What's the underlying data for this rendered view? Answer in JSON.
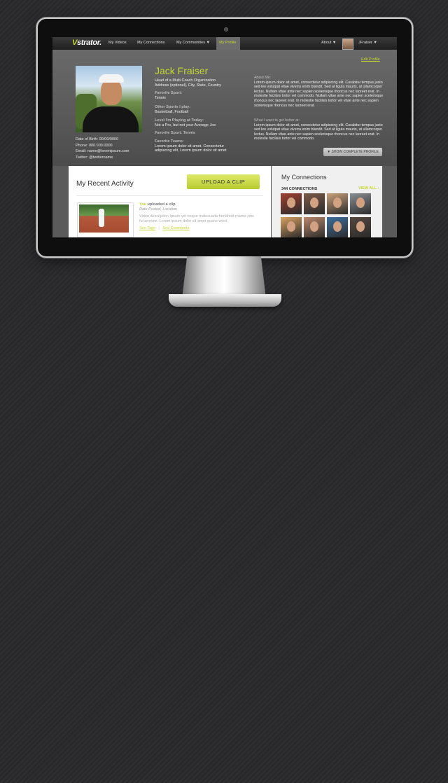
{
  "app": {
    "logo_v": "V",
    "logo_rest": "strator."
  },
  "nav": {
    "items": [
      "My Videos",
      "My Connections",
      "My Communities ▼"
    ],
    "active": "My Profile",
    "about": "About ▼",
    "user": "JFraiser ▼"
  },
  "profile": {
    "edit_link": "Edit Profile",
    "name": "Jack Fraiser",
    "headline_1": "Head of a Multi Coach Organization",
    "headline_2": "Address (optional), City, State, Country",
    "favorite_sport_label": "Favorite Sport:",
    "favorite_sport_value": "Tennis",
    "other_sports_label": "Other Sports I play:",
    "other_sports_value": "Basketball, Football",
    "level_label": "Level I'm Playing at Today:",
    "level_value": "Not a Pro, but not your Average Joe",
    "favorite_sport_line": "Favorite Sport: Tennis",
    "teams_label": "Favorite Teams:",
    "teams_value": "Lorem ipsum dolor sit amet, Consectetur adipiscing elit, Lorem ipsum dolor sit amet",
    "dob": "Date of Birth: 00/00/0000",
    "phone": "Phone: 000.000.0000",
    "email": "Email: name@loremipsum.com",
    "twitter": "Twitter: @twittername",
    "about_label": "About Me:",
    "about_text": "Lorem ipsum dolor sit amet, consectetur adipiscing elit. Curabitur tempus justo sed leo volutpat vitae viverra enim blandit. Sed at ligula mauris, at ullamcorper lectus. Nullam vitae ante nec sapien scelerisque rhoncus nec laoreet erat. In molestie facilisis tortor vel commodo. Nullam vitae ante nec sapien scelerisque rhoncus nec laoreet erat. In molestie facilisis tortor vel vitae ante nec sapien scelerisque rhoncus nec laoreet erat.",
    "better_label": "What I want to get better at:",
    "better_text": "Lorem ipsum dolor sit amet, consectetur adipiscing elit. Curabitur tempus justo sed leo volutpat vitae viverra enim blandit. Sed at ligula mauris, at ullamcorper lectus. Nullam vitae ante nec sapien scelerisque rhoncus nec laoreet erat. In molestie facilisis tortor vel commodo.",
    "show_complete": "▼ SHOW COMPLETE PROFILE"
  },
  "activity": {
    "title": "My Recent Activity",
    "upload_button": "UPLOAD A CLIP",
    "item": {
      "you": "You",
      "action": "uploaded a clip",
      "meta": "Date Posted, Location",
      "description": "Video description ipsum vel neque malesuada hendrerit rname zine ful aneone. Lorem ipsum dolor sit amet quane wiert.",
      "see_tags": "See Tags",
      "see_comments": "See Comments"
    }
  },
  "connections": {
    "title": "My Connections",
    "count": "344 CONNECTIONS",
    "view_all": "VIEW ALL ›",
    "avatar_colors": [
      "#a0402f",
      "#7b5a48",
      "#c9a07a",
      "#8a8f95",
      "#d8a160",
      "#b9876a",
      "#3e6f9e",
      "#54473f"
    ]
  }
}
